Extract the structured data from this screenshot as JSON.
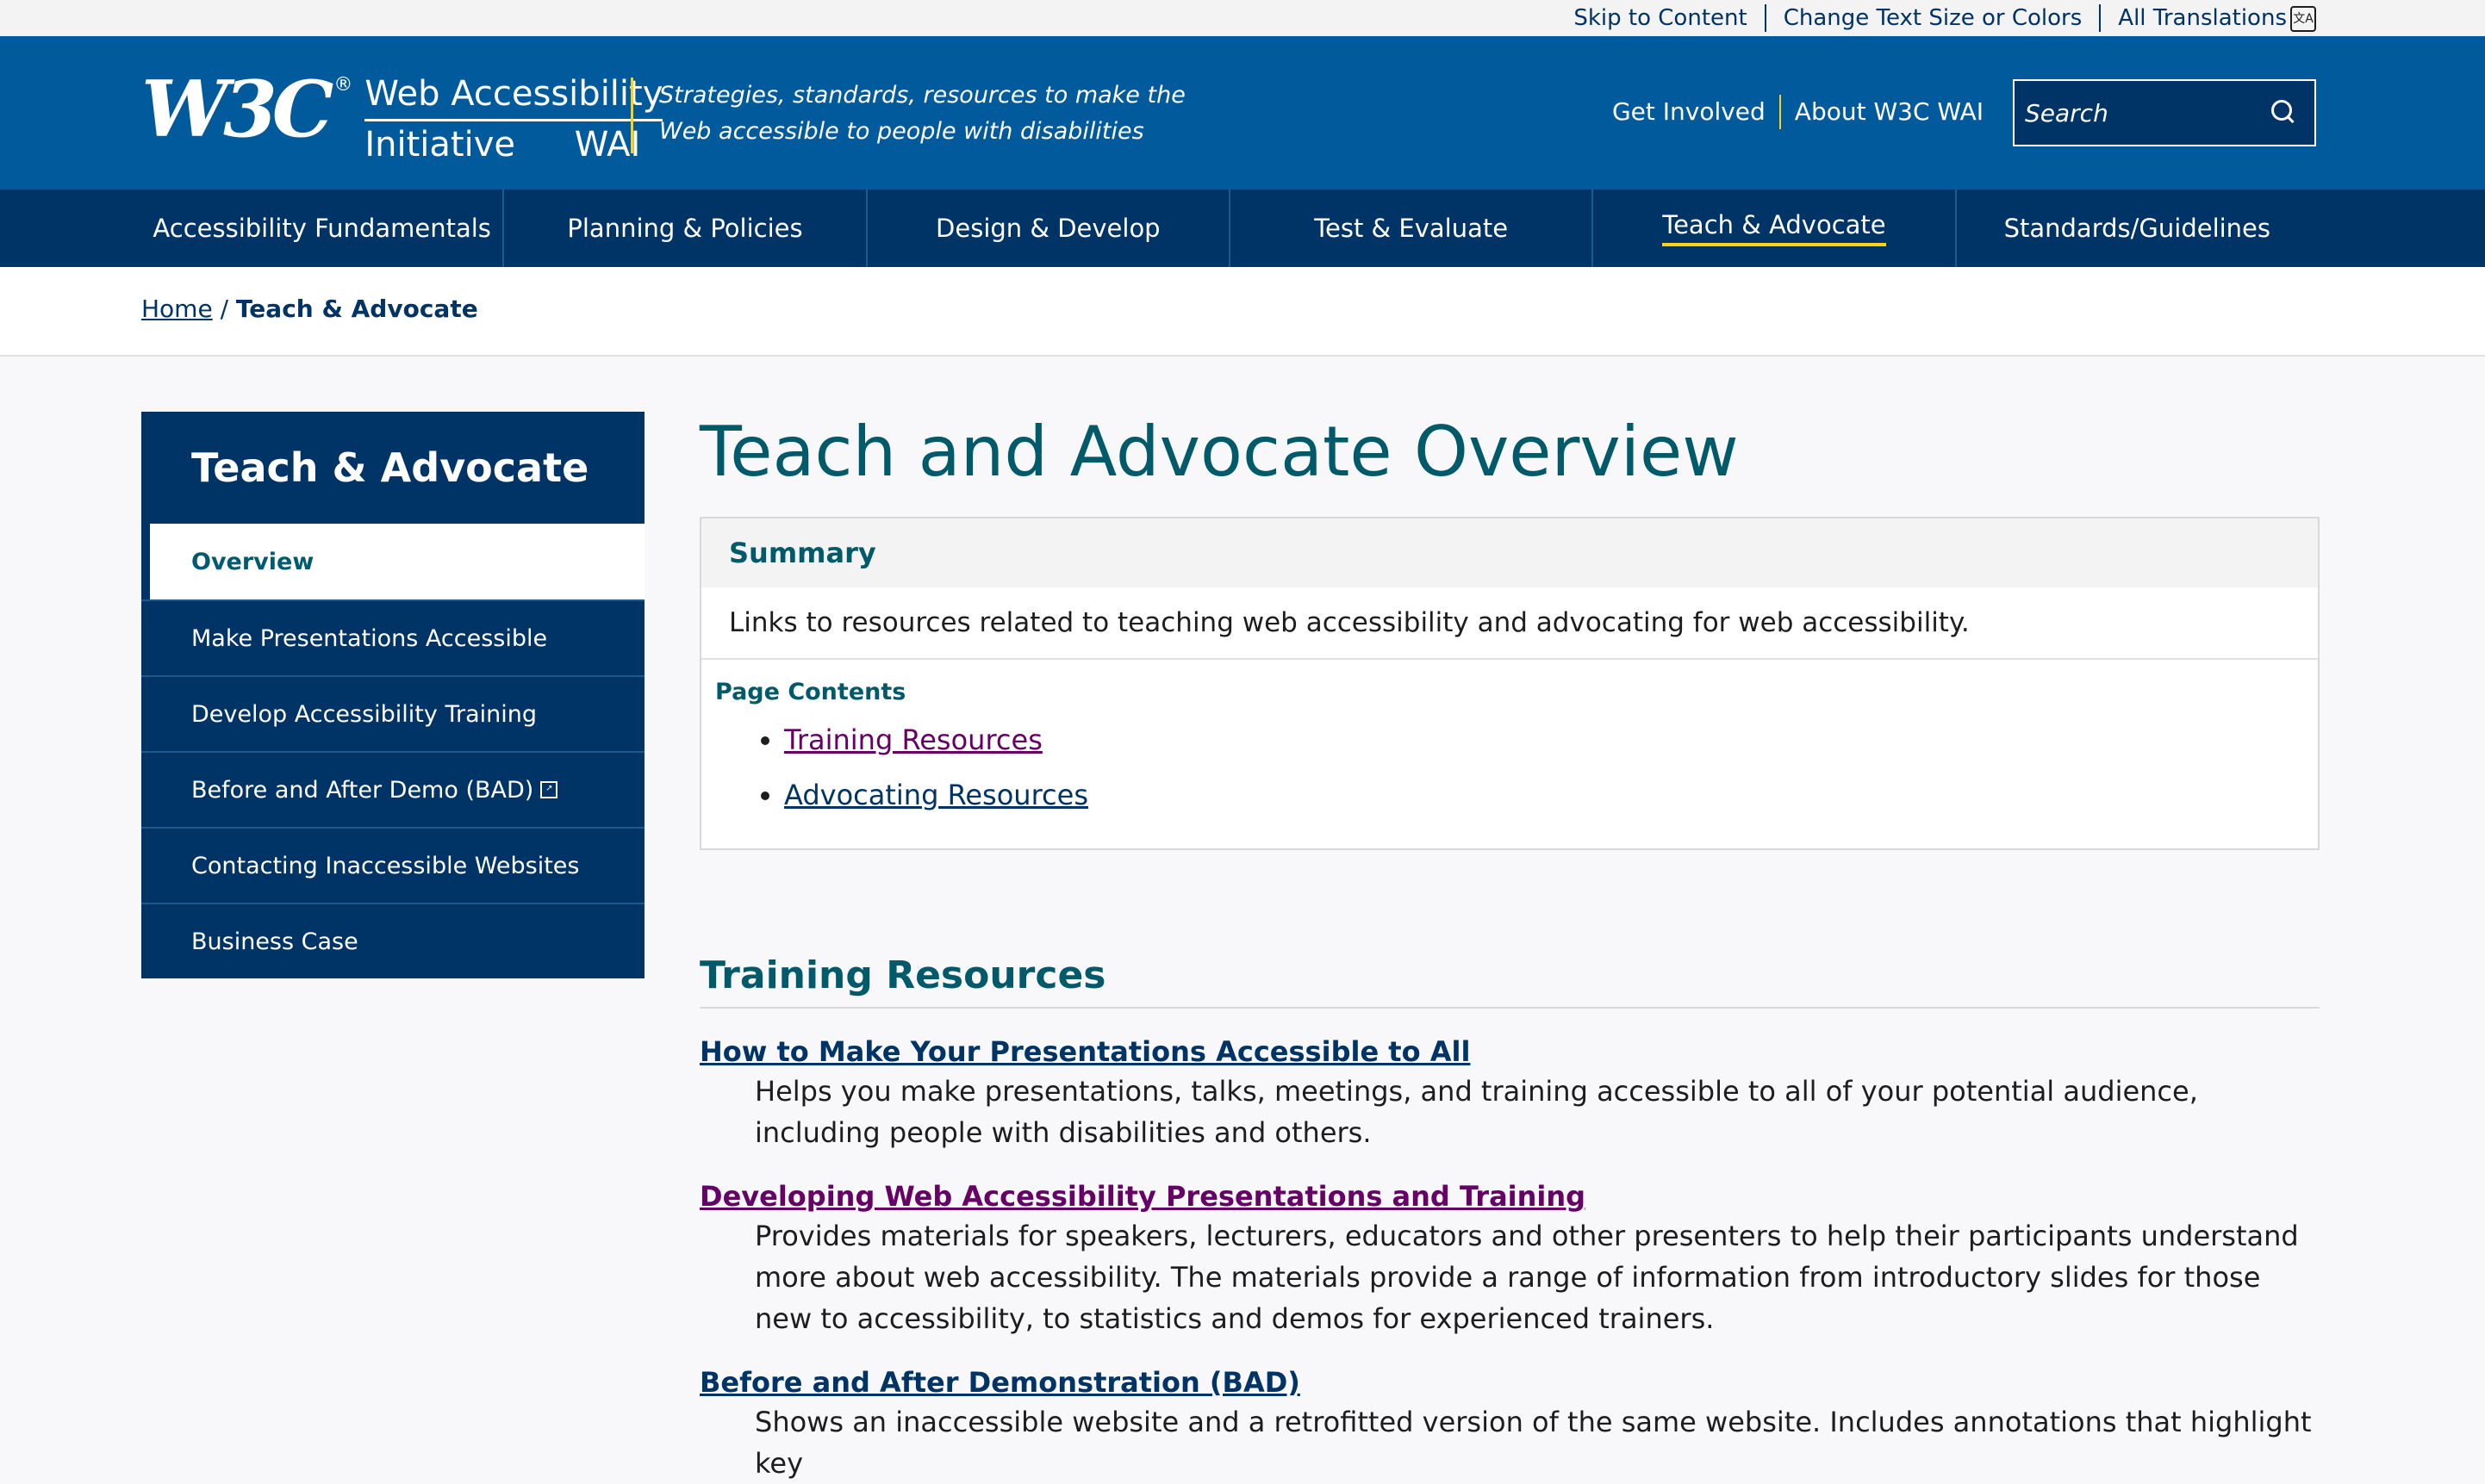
{
  "utility": {
    "skip": "Skip to Content",
    "text_size": "Change Text Size or Colors",
    "translations": "All Translations"
  },
  "header": {
    "logo_w3c": "W3C",
    "logo_reg": "®",
    "logo_line1": "Web Accessibility",
    "logo_line2a": "Initiative",
    "logo_line2b": "WAI",
    "tagline": "Strategies, standards, resources to make the Web accessible to people with disabilities",
    "nav_get_involved": "Get Involved",
    "nav_about": "About W3C WAI",
    "search_placeholder": "Search"
  },
  "mainnav": [
    "Accessibility Fundamentals",
    "Planning & Policies",
    "Design & Develop",
    "Test & Evaluate",
    "Teach & Advocate",
    "Standards/Guidelines"
  ],
  "breadcrumb": {
    "home": "Home",
    "sep": " / ",
    "current": "Teach & Advocate"
  },
  "sidebar": {
    "title": "Teach & Advocate",
    "items": [
      "Overview",
      "Make Presentations Accessible",
      "Develop Accessibility Training",
      "Before and After Demo (BAD)",
      "Contacting Inaccessible Websites",
      "Business Case"
    ]
  },
  "main": {
    "title": "Teach and Advocate Overview",
    "summary_heading": "Summary",
    "summary_text": "Links to resources related to teaching web accessibility and advocating for web accessibility.",
    "toc_heading": "Page Contents",
    "toc": [
      "Training Resources",
      "Advocating Resources"
    ],
    "section_title": "Training Resources",
    "entries": [
      {
        "title": "How to Make Your Presentations Accessible to All",
        "desc": "Helps you make presentations, talks, meetings, and training accessible to all of your potential audience, including people with disabilities and others."
      },
      {
        "title": "Developing Web Accessibility Presentations and Training",
        "desc": "Provides materials for speakers, lecturers, educators and other presenters to help their participants understand more about web accessibility. The materials provide a range of information from introductory slides for those new to accessibility, to statistics and demos for experienced trainers."
      },
      {
        "title": "Before and After Demonstration (BAD)",
        "desc": "Shows an inaccessible website and a retrofitted version of the same website. Includes annotations that highlight key"
      }
    ]
  }
}
